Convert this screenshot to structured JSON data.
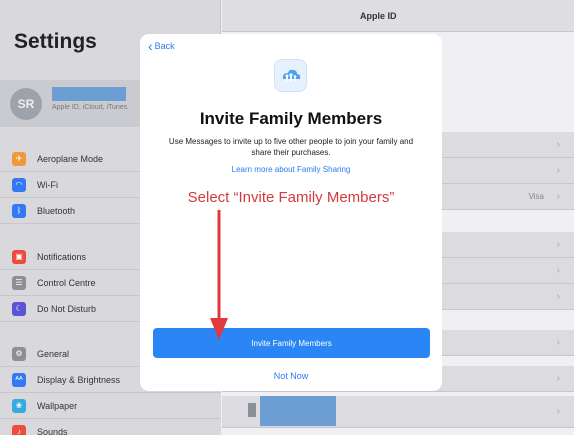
{
  "sidebar": {
    "title": "Settings",
    "account": {
      "initials": "SR",
      "subtitle": "Apple ID, iCloud, iTunes"
    },
    "groups": [
      {
        "items": [
          {
            "label": "Aeroplane Mode",
            "icon": "airplane-icon",
            "color": "#f09a37"
          },
          {
            "label": "Wi-Fi",
            "icon": "wifi-icon",
            "color": "#3478f6"
          },
          {
            "label": "Bluetooth",
            "icon": "bluetooth-icon",
            "color": "#3478f6"
          }
        ]
      },
      {
        "items": [
          {
            "label": "Notifications",
            "icon": "notifications-icon",
            "color": "#eb4d3d"
          },
          {
            "label": "Control Centre",
            "icon": "control-centre-icon",
            "color": "#8e8e93"
          },
          {
            "label": "Do Not Disturb",
            "icon": "moon-icon",
            "color": "#5856d6"
          }
        ]
      },
      {
        "items": [
          {
            "label": "General",
            "icon": "gear-icon",
            "color": "#8e8e93"
          },
          {
            "label": "Display & Brightness",
            "icon": "display-icon",
            "color": "#3478f6"
          },
          {
            "label": "Wallpaper",
            "icon": "wallpaper-icon",
            "color": "#36aadc"
          },
          {
            "label": "Sounds",
            "icon": "sounds-icon",
            "color": "#eb4d3d"
          }
        ]
      }
    ]
  },
  "detail": {
    "title": "Apple ID",
    "payment_value": "Visa"
  },
  "modal": {
    "back_label": "Back",
    "title": "Invite Family Members",
    "description": "Use Messages to invite up to five other people to join your family and share their purchases.",
    "learn_more": "Learn more about Family Sharing",
    "annotation": "Select “Invite Family Members”",
    "invite_button": "Invite Family Members",
    "not_now": "Not Now"
  },
  "colors": {
    "accent": "#2a86f5",
    "annotation_red": "#d33a3e"
  }
}
